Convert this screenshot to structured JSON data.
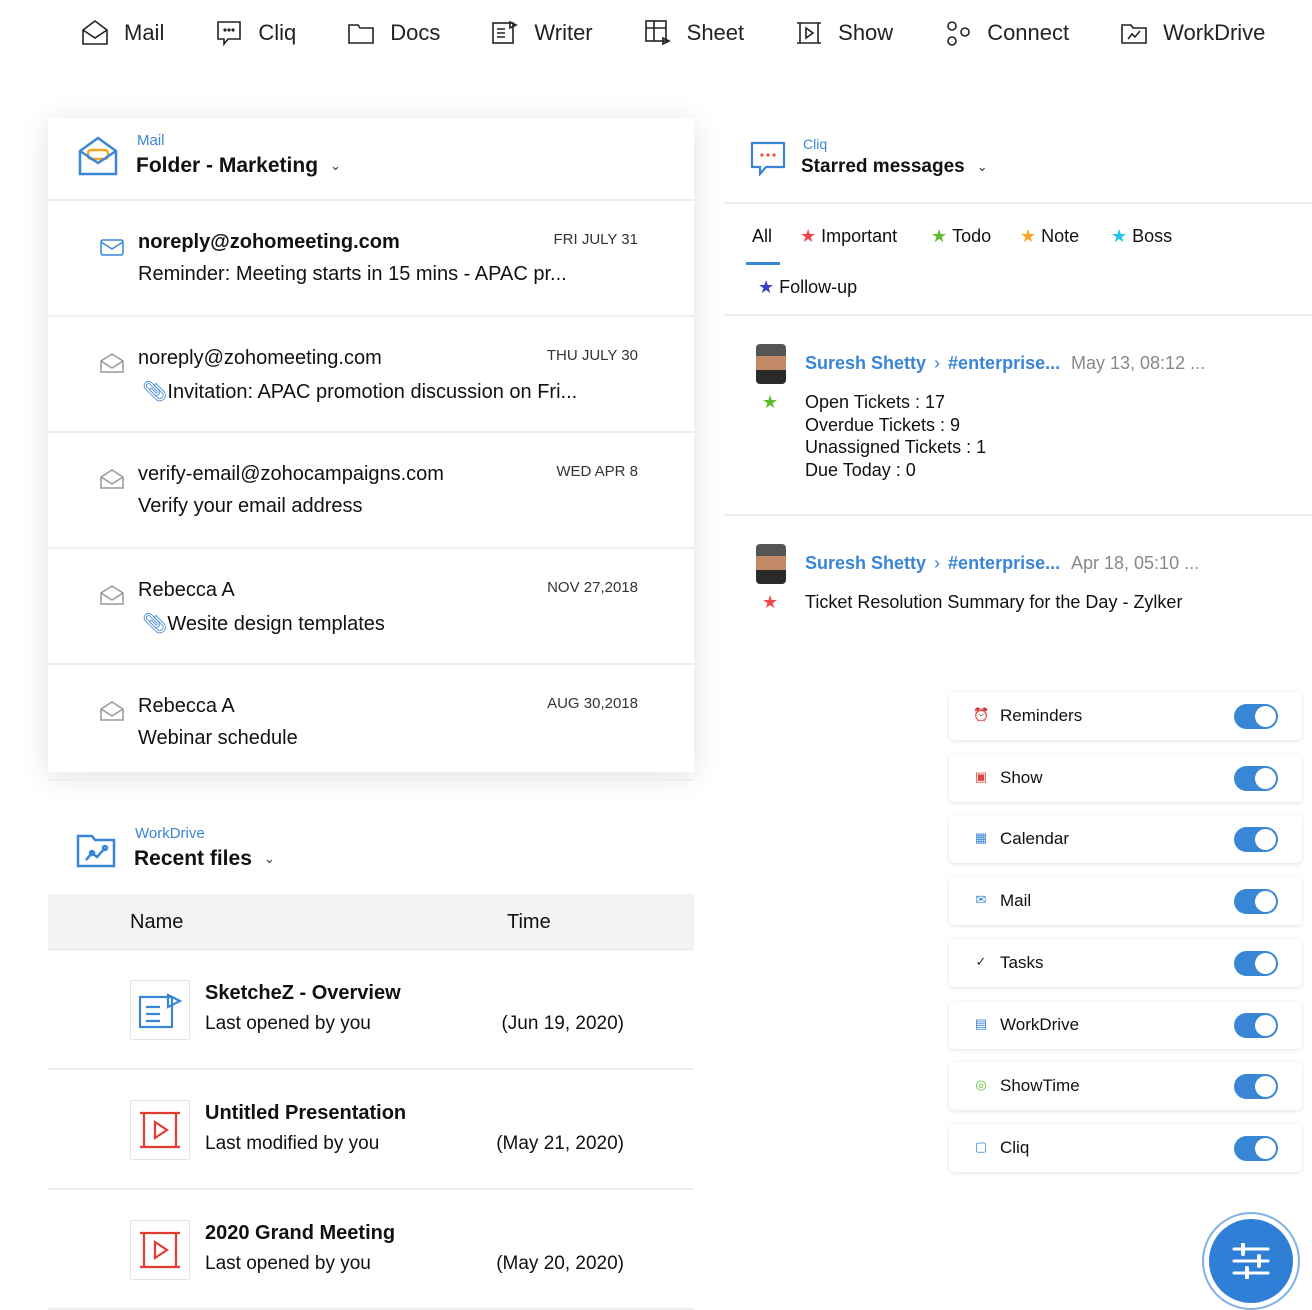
{
  "nav": [
    "Mail",
    "Cliq",
    "Docs",
    "Writer",
    "Sheet",
    "Show",
    "Connect",
    "WorkDrive"
  ],
  "mail": {
    "app": "Mail",
    "folder": "Folder - Marketing",
    "rows": [
      {
        "from": "noreply@zohomeeting.com",
        "subject": "Reminder: Meeting starts in 15 mins - APAC pr...",
        "date": "FRI JULY 31",
        "unread": true,
        "attach": false
      },
      {
        "from": "noreply@zohomeeting.com",
        "subject": "Invitation: APAC promotion discussion on Fri...",
        "date": "THU JULY 30",
        "unread": false,
        "attach": true
      },
      {
        "from": "verify-email@zohocampaigns.com",
        "subject": "Verify your email address",
        "date": "WED APR 8",
        "unread": false,
        "attach": false
      },
      {
        "from": "Rebecca A",
        "subject": "Wesite design templates",
        "date": "NOV 27,2018",
        "unread": false,
        "attach": true
      },
      {
        "from": "Rebecca A",
        "subject": "Webinar schedule",
        "date": "AUG 30,2018",
        "unread": false,
        "attach": false
      }
    ]
  },
  "workdrive": {
    "app": "WorkDrive",
    "title": "Recent files",
    "col_name": "Name",
    "col_time": "Time",
    "files": [
      {
        "name": "SketcheZ - Overview",
        "status": "Last opened by you",
        "time": "(Jun 19, 2020)",
        "type": "writer"
      },
      {
        "name": "Untitled Presentation",
        "status": "Last modified by you",
        "time": "(May 21, 2020)",
        "type": "show"
      },
      {
        "name": "2020 Grand Meeting",
        "status": "Last opened by you",
        "time": "(May 20, 2020)",
        "type": "show"
      }
    ]
  },
  "cliq": {
    "app": "Cliq",
    "title": "Starred messages",
    "tabs": [
      {
        "label": "All",
        "color": ""
      },
      {
        "label": "Important",
        "color": "#f04a4a"
      },
      {
        "label": "Todo",
        "color": "#5dbb2c"
      },
      {
        "label": "Note",
        "color": "#f6a623"
      },
      {
        "label": "Boss",
        "color": "#1ec6e6"
      },
      {
        "label": "Follow-up",
        "color": "#3a3fc8"
      }
    ],
    "messages": [
      {
        "sender": "Suresh Shetty",
        "channel": "#enterprise...",
        "time": "May 13, 08:12 ...",
        "star": "#5dbb2c",
        "lines": [
          "Open Tickets : 17",
          "Overdue Tickets : 9",
          "Unassigned Tickets : 1",
          "Due Today : 0"
        ]
      },
      {
        "sender": "Suresh Shetty",
        "channel": "#enterprise...",
        "time": "Apr 18, 05:10 ...",
        "star": "#f04a4a",
        "lines": [
          "Ticket Resolution Summary for the Day - Zylker"
        ]
      }
    ]
  },
  "toggles": [
    {
      "label": "Reminders",
      "icon": "⏰",
      "color": "#3a86d6",
      "on": true
    },
    {
      "label": "Show",
      "icon": "▣",
      "color": "#d9463b",
      "on": true
    },
    {
      "label": "Calendar",
      "icon": "▦",
      "color": "#3a86d6",
      "on": true
    },
    {
      "label": "Mail",
      "icon": "✉",
      "color": "#3a86d6",
      "on": true
    },
    {
      "label": "Tasks",
      "icon": "✓",
      "color": "#333",
      "on": true
    },
    {
      "label": "WorkDrive",
      "icon": "▤",
      "color": "#3a86d6",
      "on": true
    },
    {
      "label": "ShowTime",
      "icon": "◎",
      "color": "#5dbb2c",
      "on": true
    },
    {
      "label": "Cliq",
      "icon": "▢",
      "color": "#3a86d6",
      "on": true
    }
  ]
}
